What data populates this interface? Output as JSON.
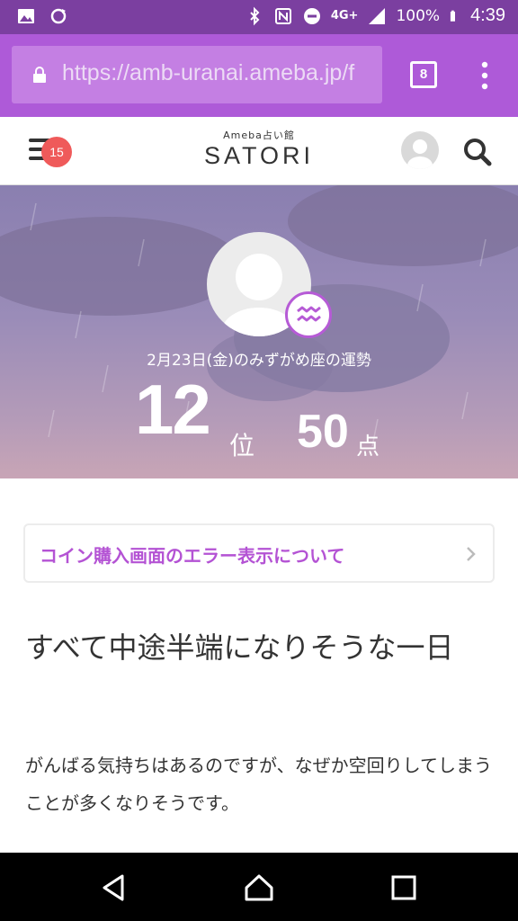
{
  "status_bar": {
    "network": "4G+",
    "battery": "100%",
    "time": "4:39"
  },
  "browser": {
    "url": "https://amb-uranai.ameba.jp/f",
    "tab_count": "8"
  },
  "site_header": {
    "logo_sub": "Ameba占い館",
    "logo_main": "SATORI",
    "notification_count": "15"
  },
  "hero": {
    "fortune_date": "2月23日(金)のみずがめ座の運勢",
    "rank": "12",
    "rank_unit": "位",
    "score": "50",
    "score_unit": "点",
    "zodiac_icon": "aquarius-icon"
  },
  "notice": {
    "label": "コイン購入画面のエラー表示について"
  },
  "article": {
    "headline": "すべて中途半端になりそうな一日",
    "body": "がんばる気持ちはあるのですが、なぜか空回りしてしまうことが多くなりそうです。"
  },
  "colors": {
    "status_bar": "#7b3fa0",
    "toolbar": "#ae5ad8",
    "accent": "#b453d4",
    "badge": "#ef5a5a"
  }
}
